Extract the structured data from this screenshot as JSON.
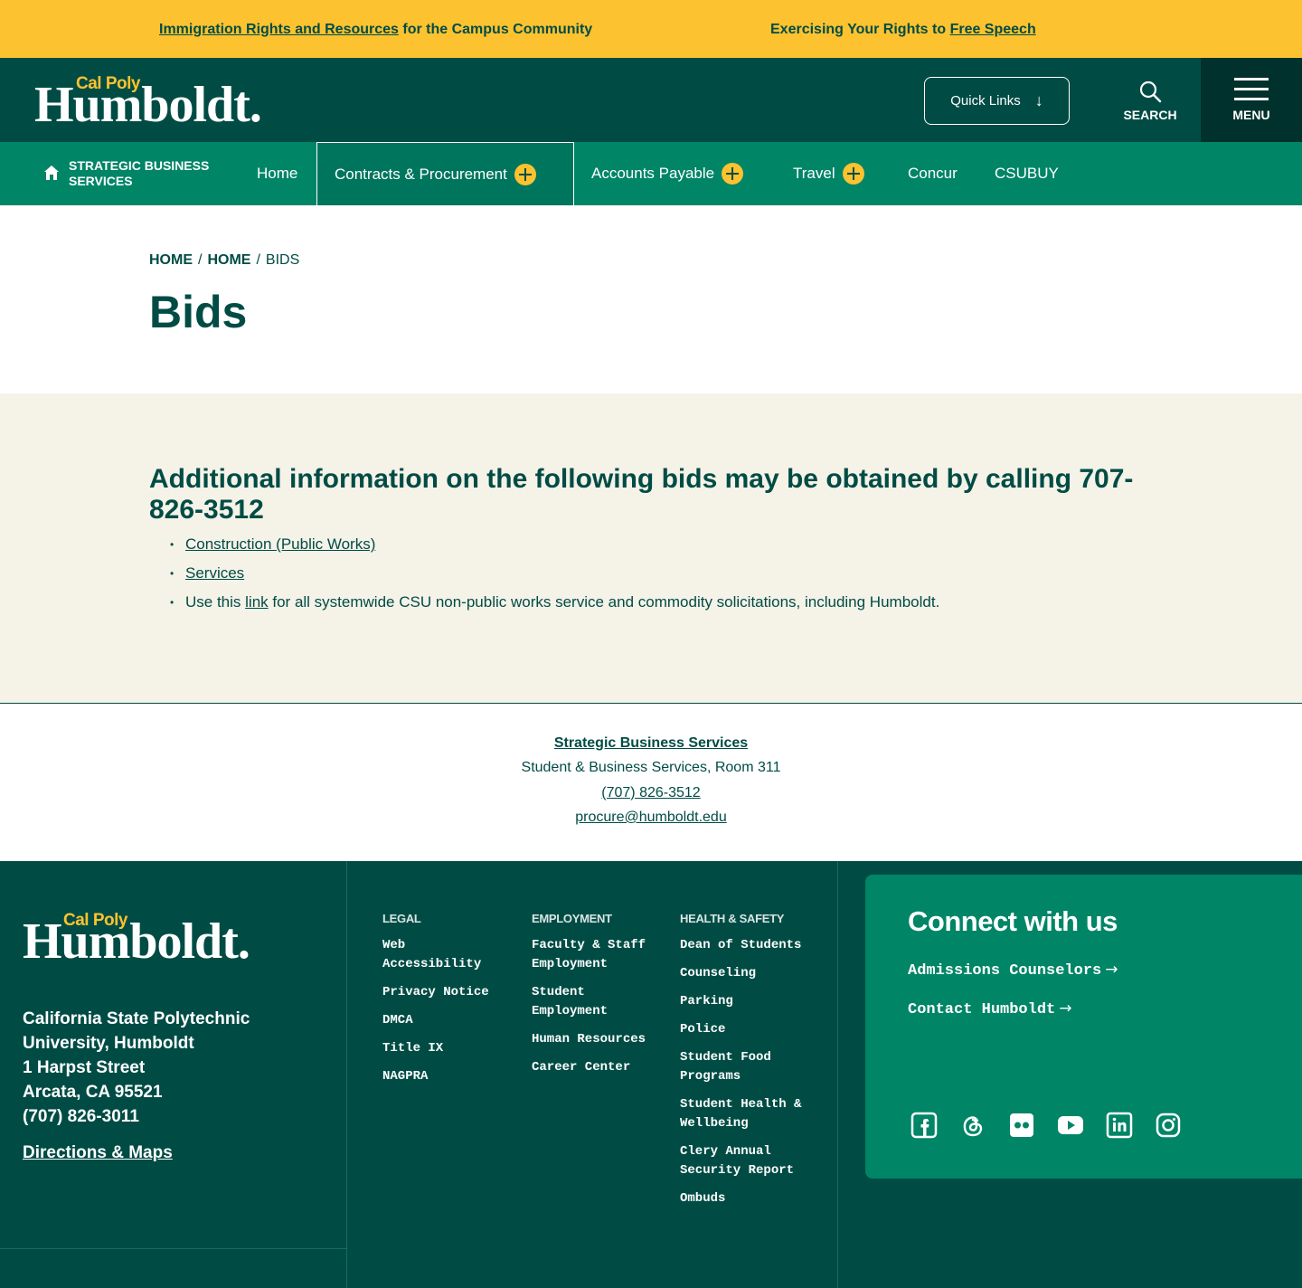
{
  "alerts": {
    "left_link": "Immigration Rights and Resources",
    "left_rest": " for the Campus Community",
    "right_text": "Exercising Your Rights to ",
    "right_link": "Free Speech"
  },
  "brand": {
    "cal_poly": "Cal Poly",
    "humboldt": "Humboldt."
  },
  "header": {
    "quick_links": "Quick Links",
    "search": "SEARCH",
    "menu": "MENU"
  },
  "nav": {
    "site_name": "STRATEGIC BUSINESS SERVICES",
    "items": [
      {
        "label": "Home"
      },
      {
        "label": "Contracts & Procurement"
      },
      {
        "label": "Accounts Payable"
      },
      {
        "label": "Travel"
      },
      {
        "label": "Concur"
      },
      {
        "label": "CSUBUY"
      }
    ]
  },
  "breadcrumb": [
    "HOME",
    "HOME",
    "BIDS"
  ],
  "page_title": "Bids",
  "content": {
    "heading": "Additional information on the following bids may be obtained by calling 707-826-3512",
    "items": [
      {
        "link": "Construction (Public Works)"
      },
      {
        "link": "Services"
      }
    ],
    "systemwide_pre": "Use this ",
    "systemwide_link": "link",
    "systemwide_post": " for all systemwide CSU non-public works service and commodity solicitations, including Humboldt."
  },
  "contact": {
    "name": "Strategic Business Services",
    "location": "Student & Business Services, Room 311",
    "phone": "(707) 826-3512",
    "email": "procure@humboldt.edu"
  },
  "footer": {
    "address": [
      "California State Polytechnic",
      "University, Humboldt",
      "1 Harpst Street",
      "Arcata, CA 95521",
      "(707) 826-3011"
    ],
    "directions": "Directions & Maps",
    "legal": {
      "heading": "LEGAL",
      "links": [
        "Web Accessibility",
        "Privacy Notice",
        "DMCA",
        "Title IX",
        "NAGPRA"
      ]
    },
    "employment": {
      "heading": "EMPLOYMENT",
      "links": [
        "Faculty & Staff Employment",
        "Student Employment",
        "Human Resources",
        "Career Center"
      ]
    },
    "health": {
      "heading": "HEALTH & SAFETY",
      "links": [
        "Dean of Students",
        "Counseling",
        "Parking",
        "Police",
        "Student Food Programs",
        "Student Health & Wellbeing",
        "Clery Annual Security Report",
        "Ombuds"
      ]
    },
    "connect": {
      "heading": "Connect with us",
      "links": [
        "Admissions Counselors",
        "Contact Humboldt"
      ]
    },
    "social_icons": [
      "facebook-icon",
      "threads-icon",
      "flickr-icon",
      "youtube-icon",
      "linkedin-icon",
      "instagram-icon"
    ]
  },
  "colors": {
    "dark_green": "#004c45",
    "green": "#008567",
    "gold": "#fdc22f",
    "cream": "#f5f2e8"
  }
}
